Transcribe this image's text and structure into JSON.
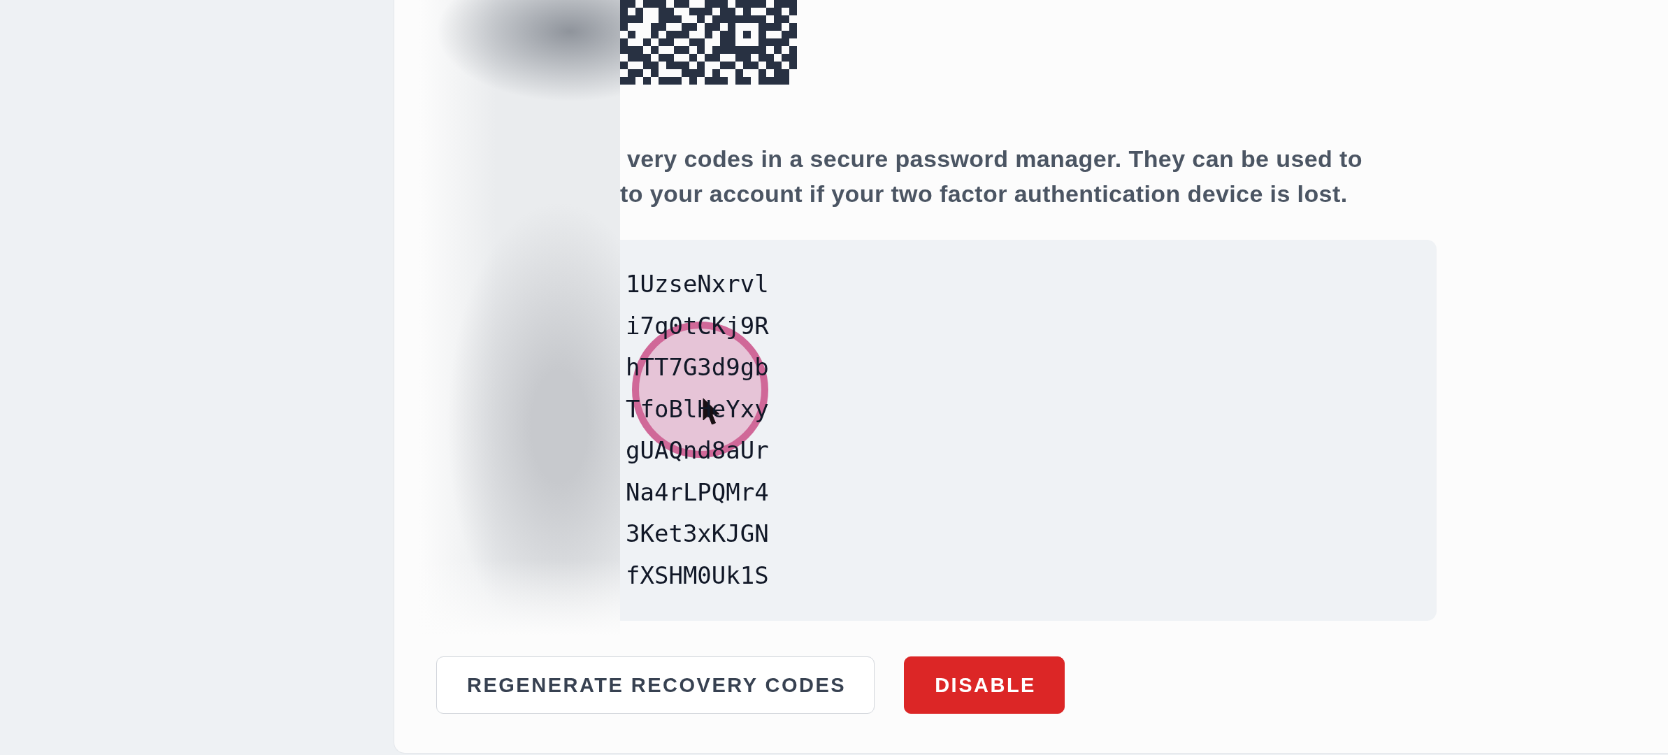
{
  "note": {
    "lines": [
      "very codes in a secure password manager. They can be used to",
      "to your account if your two factor authentication device is lost."
    ]
  },
  "recovery_codes": [
    "1UzseNxrvl",
    "i7q0tCKj9R",
    "hTT7G3d9gb",
    "TfoBlHeYxy",
    "gUAQnd8aUr",
    "Na4rLPQMr4",
    "3Ket3xKJGN",
    "fXSHM0Uk1S"
  ],
  "buttons": [
    {
      "label": "REGENERATE RECOVERY CODES",
      "kind": "secondary"
    },
    {
      "label": "DISABLE",
      "kind": "danger"
    }
  ]
}
